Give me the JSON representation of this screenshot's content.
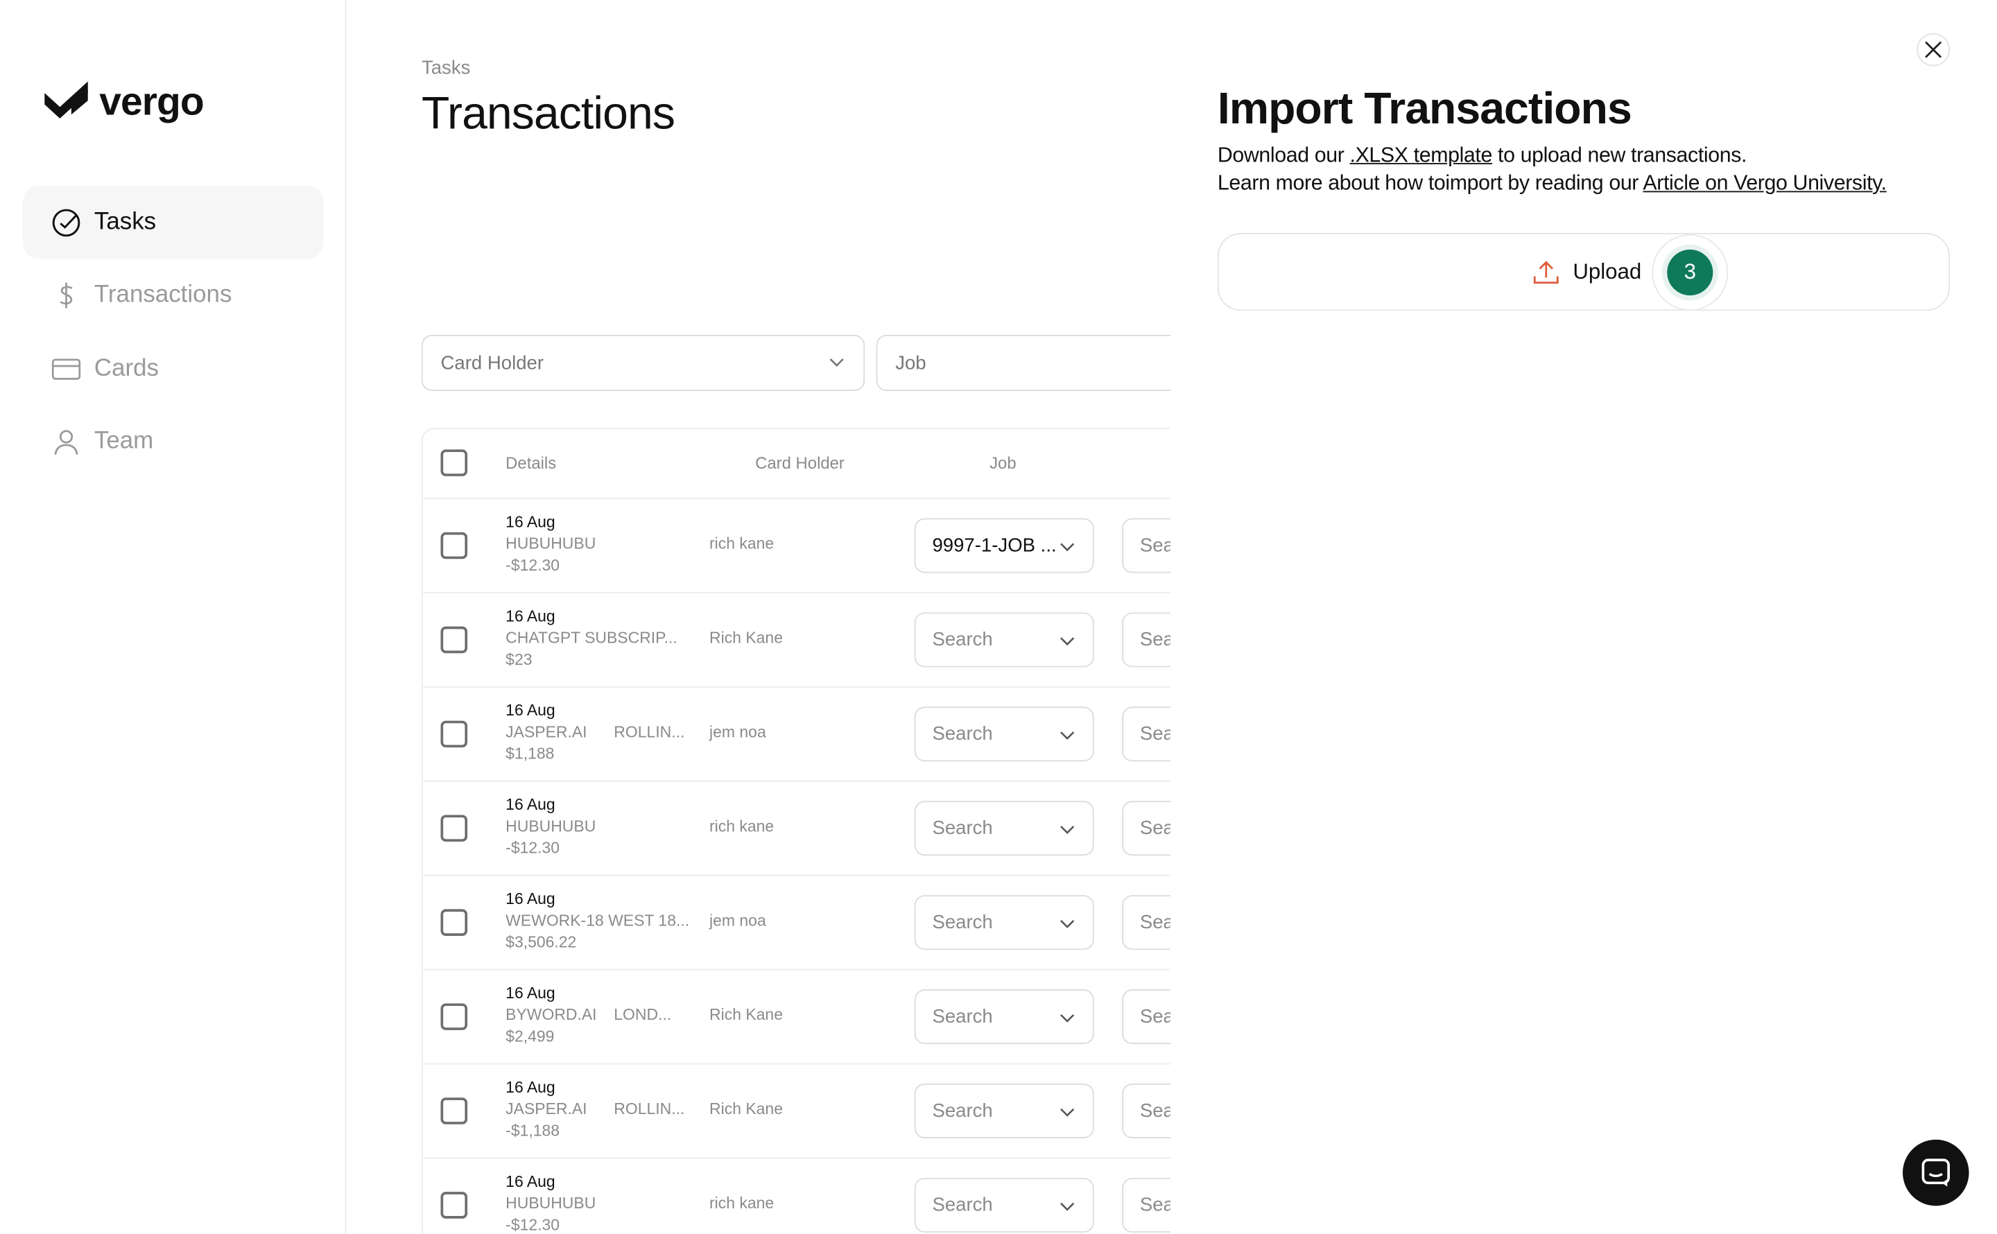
{
  "brand": {
    "name": "vergo"
  },
  "sidebar": {
    "items": [
      {
        "label": "Tasks",
        "icon": "check-circle-icon",
        "active": true
      },
      {
        "label": "Transactions",
        "icon": "dollar-icon",
        "active": false
      },
      {
        "label": "Cards",
        "icon": "card-icon",
        "active": false
      },
      {
        "label": "Team",
        "icon": "user-icon",
        "active": false
      }
    ]
  },
  "header": {
    "breadcrumb": "Tasks",
    "title": "Transactions"
  },
  "filters": {
    "card_holder_placeholder": "Card Holder",
    "job_placeholder": "Job"
  },
  "table": {
    "columns": {
      "details": "Details",
      "card_holder": "Card Holder",
      "job": "Job"
    },
    "rows": [
      {
        "date": "16 Aug",
        "merchant": "HUBUHUBU",
        "location": "",
        "amount": "-$12.30",
        "holder": "rich kane",
        "job": "9997-1-JOB ...",
        "job_filled": true,
        "second": "Sea"
      },
      {
        "date": "16 Aug",
        "merchant": "CHATGPT SUBSCRIP...",
        "location": "",
        "amount": "$23",
        "holder": "Rich Kane",
        "job": "Search",
        "job_filled": false,
        "second": "Sea"
      },
      {
        "date": "16 Aug",
        "merchant": "JASPER.AI",
        "location": "ROLLIN...",
        "amount": "$1,188",
        "holder": "jem noa",
        "job": "Search",
        "job_filled": false,
        "second": "Sea"
      },
      {
        "date": "16 Aug",
        "merchant": "HUBUHUBU",
        "location": "",
        "amount": "-$12.30",
        "holder": "rich kane",
        "job": "Search",
        "job_filled": false,
        "second": "Sea"
      },
      {
        "date": "16 Aug",
        "merchant": "WEWORK-18 WEST 18...",
        "location": "",
        "amount": "$3,506.22",
        "holder": "jem noa",
        "job": "Search",
        "job_filled": false,
        "second": "Sea"
      },
      {
        "date": "16 Aug",
        "merchant": "BYWORD.AI",
        "location": "LOND...",
        "amount": "$2,499",
        "holder": "Rich Kane",
        "job": "Search",
        "job_filled": false,
        "second": "Sea"
      },
      {
        "date": "16 Aug",
        "merchant": "JASPER.AI",
        "location": "ROLLIN...",
        "amount": "-$1,188",
        "holder": "Rich Kane",
        "job": "Search",
        "job_filled": false,
        "second": "Sea"
      },
      {
        "date": "16 Aug",
        "merchant": "HUBUHUBU",
        "location": "",
        "amount": "-$12.30",
        "holder": "rich kane",
        "job": "Search",
        "job_filled": false,
        "second": "Sea"
      }
    ]
  },
  "import_panel": {
    "title": "Import Transactions",
    "line1_prefix": "Download our ",
    "line1_link": ".XLSX template",
    "line1_suffix": " to upload new transactions.",
    "line2_prefix": "Learn more about how toimport by reading our ",
    "line2_link": "Article on Vergo University.",
    "upload_label": "Upload",
    "upload_count": "3",
    "badge_color": "#0f7a5a",
    "upload_icon_color": "#e05a3a"
  }
}
